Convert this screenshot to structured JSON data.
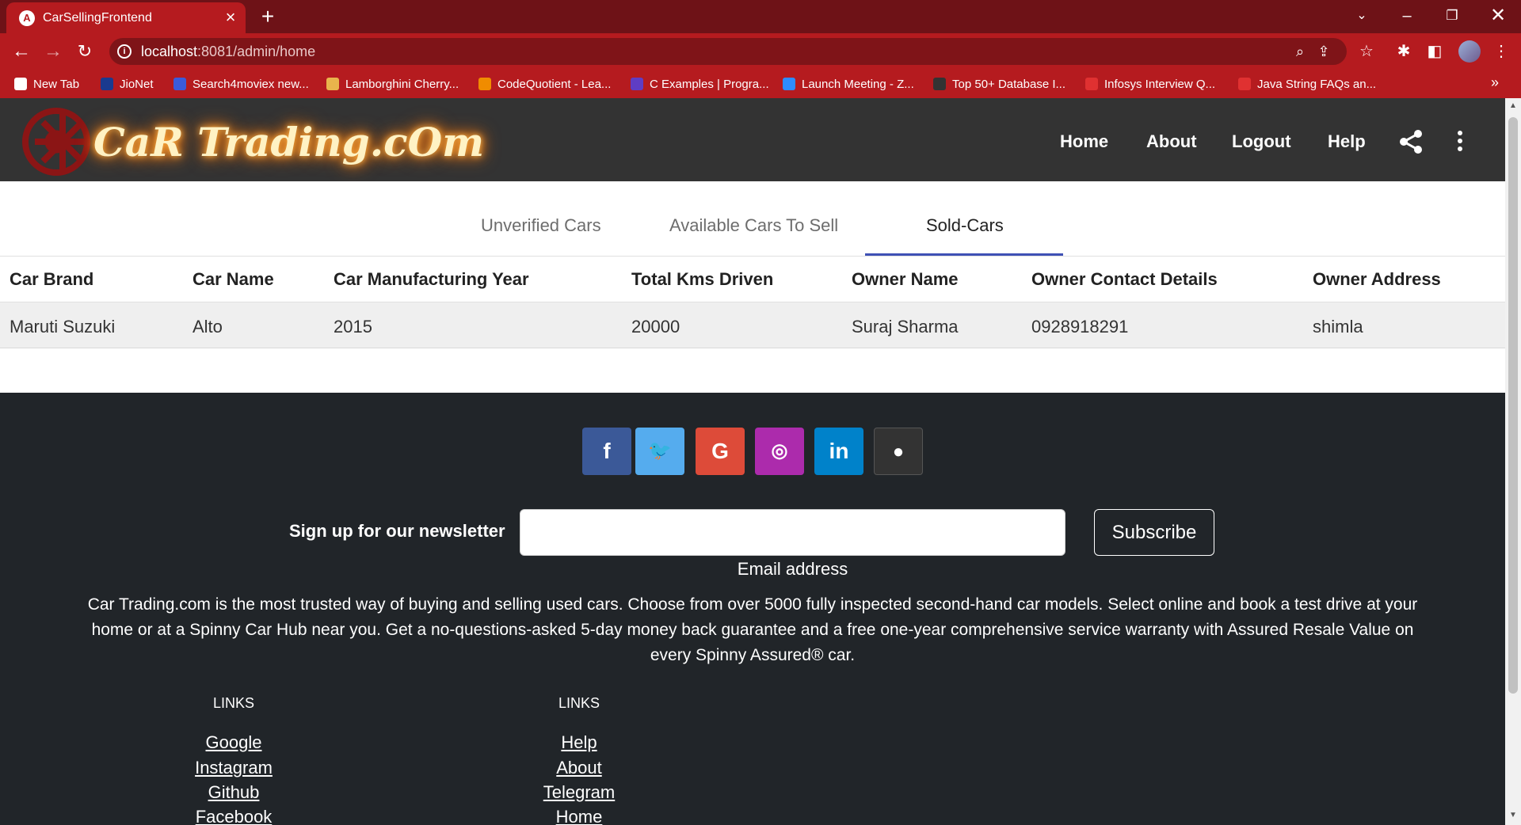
{
  "browser": {
    "tab_title": "CarSellingFrontend",
    "tab_favicon": "A",
    "url_host": "localhost",
    "url_rest": ":8081/admin/home",
    "bookmarks": [
      {
        "label": "New Tab",
        "color": "#ffffff"
      },
      {
        "label": "JioNet",
        "color": "#1a3a8f"
      },
      {
        "label": "Search4moviex new...",
        "color": "#3b5bdb"
      },
      {
        "label": "Lamborghini Cherry...",
        "color": "#e9b44c"
      },
      {
        "label": "CodeQuotient - Lea...",
        "color": "#f08c00"
      },
      {
        "label": "C Examples | Progra...",
        "color": "#5f3dc4"
      },
      {
        "label": "Launch Meeting - Z...",
        "color": "#2d8cff"
      },
      {
        "label": "Top 50+ Database I...",
        "color": "#333333"
      },
      {
        "label": "Infosys Interview Q...",
        "color": "#e03131"
      },
      {
        "label": "Java String FAQs an...",
        "color": "#e03131"
      }
    ],
    "more_bookmarks": "»"
  },
  "header": {
    "logo_text": "CaR Trading.cOm",
    "nav": [
      "Home",
      "About",
      "Logout",
      "Help"
    ]
  },
  "tabs": [
    {
      "label": "Unverified Cars",
      "active": false
    },
    {
      "label": "Available Cars To Sell",
      "active": false
    },
    {
      "label": "Sold-Cars",
      "active": true
    }
  ],
  "table": {
    "columns": [
      "Car Brand",
      "Car Name",
      "Car Manufacturing Year",
      "Total Kms Driven",
      "Owner Name",
      "Owner Contact Details",
      "Owner Address"
    ],
    "rows": [
      [
        "Maruti Suzuki",
        "Alto",
        "2015",
        "20000",
        "Suraj Sharma",
        "0928918291",
        "shimla"
      ]
    ]
  },
  "footer": {
    "social": [
      {
        "name": "facebook",
        "glyph": "f",
        "color": "#3b5998"
      },
      {
        "name": "twitter",
        "glyph": "🐦",
        "color": "#55acee"
      },
      {
        "name": "google",
        "glyph": "G",
        "color": "#dd4b39"
      },
      {
        "name": "instagram",
        "glyph": "◎",
        "color": "#ac2bac"
      },
      {
        "name": "linkedin",
        "glyph": "in",
        "color": "#0082ca"
      },
      {
        "name": "github",
        "glyph": "●",
        "color": "#333333"
      }
    ],
    "newsletter_label": "Sign up for our newsletter",
    "email_label": "Email address",
    "subscribe_label": "Subscribe",
    "about_text": "Car Trading.com is the most trusted way of buying and selling used cars. Choose from over 5000 fully inspected second-hand car models. Select online and book a test drive at your home or at a Spinny Car Hub near you. Get a no-questions-asked 5-day money back guarantee and a free one-year comprehensive service warranty with Assured Resale Value on every Spinny Assured® car.",
    "links_col1": {
      "heading": "LINKS",
      "items": [
        "Google",
        "Instagram",
        "Github",
        "Facebook"
      ]
    },
    "links_col2": {
      "heading": "LINKS",
      "items": [
        "Help",
        "About",
        "Telegram",
        "Home"
      ]
    }
  }
}
